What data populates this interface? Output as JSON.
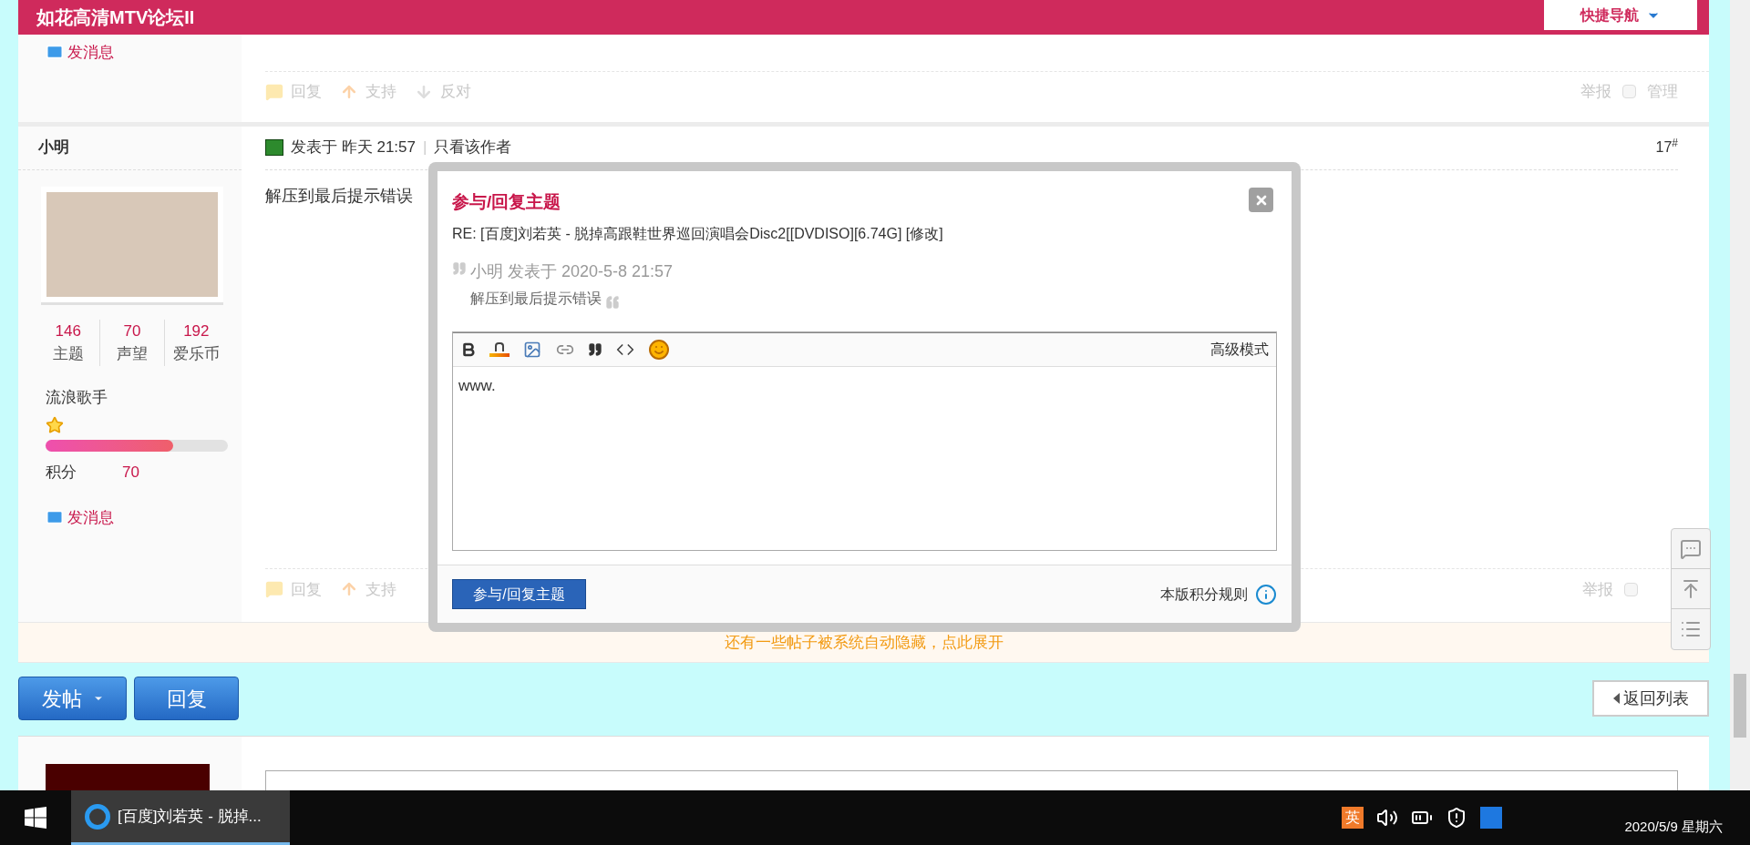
{
  "header": {
    "title": "如花高清MTV论坛II",
    "quick_nav": "快捷导航"
  },
  "previous_post": {
    "send_message": "发消息",
    "actions": [
      {
        "kind": "reply",
        "label": "回复"
      },
      {
        "kind": "support",
        "label": "支持"
      },
      {
        "kind": "oppose",
        "label": "反对"
      }
    ],
    "report": "举报",
    "manage_checked": false,
    "manage": "管理"
  },
  "post": {
    "author": "小明",
    "meta": "发表于 昨天 21:57",
    "separator": "|",
    "only_author": "只看该作者",
    "floor": "17$^{#}$",
    "content": "解压到最后提示错误",
    "stats": [
      {
        "value": "146",
        "label": "主题"
      },
      {
        "value": "70",
        "label": "声望"
      },
      {
        "value": "192",
        "label": "爱乐币"
      }
    ],
    "rank": "流浪歌手",
    "level": 0.7,
    "points_label": "积分",
    "points": "70",
    "send_message": "发消息",
    "actions": [
      {
        "kind": "reply",
        "label": "回复"
      },
      {
        "kind": "support",
        "label": "支持"
      }
    ],
    "report": "举报",
    "manage_checked": false
  },
  "notice": "还有一些帖子被系统自动隐藏，点此展开",
  "buttons": {
    "new_post": "发帖",
    "reply": "回复",
    "back": "返回列表"
  },
  "dialog": {
    "title": "参与/回复主题",
    "subject": "RE: [百度]刘若英 - 脱掉高跟鞋世界巡回演唱会Disc2[[DVDISO][6.74G] [修改]",
    "quote_meta": "小明 发表于 2020-5-8 21:57",
    "quote_text": "解压到最后提示错误",
    "advanced": "高级模式",
    "value": "www.",
    "submit": "参与/回复主题",
    "rules": "本版积分规则"
  },
  "taskbar": {
    "app_title": "[百度]刘若英 - 脱掉...",
    "ime": "英",
    "date": "2020/5/9 星期六"
  }
}
